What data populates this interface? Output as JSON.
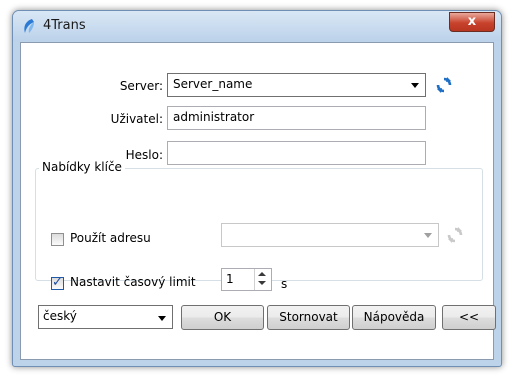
{
  "window": {
    "title": "4Trans",
    "close_label": "x"
  },
  "form": {
    "server_label": "Server:",
    "server_value": "Server_name",
    "user_label": "Uživatel:",
    "user_value": "administrator",
    "password_label": "Heslo:",
    "password_value": ""
  },
  "group": {
    "title": "Nabídky klíče",
    "use_address_label": "Použít adresu",
    "use_address_checked": false,
    "address_value": "",
    "timeout_label": "Nastavit časový limit",
    "timeout_checked": true,
    "timeout_value": "1",
    "timeout_unit": "s"
  },
  "footer": {
    "language_value": "český",
    "ok_label": "OK",
    "cancel_label": "Stornovat",
    "help_label": "Nápověda",
    "collapse_label": "<<"
  },
  "icons": {
    "app": "app-logo-icon",
    "refresh": "refresh-icon",
    "dropdown": "chevron-down-icon",
    "checkmark": "checkmark-icon"
  },
  "colors": {
    "accent": "#1f6fc5",
    "title_bar": "#bcd2ea",
    "close_button": "#c8432c"
  }
}
